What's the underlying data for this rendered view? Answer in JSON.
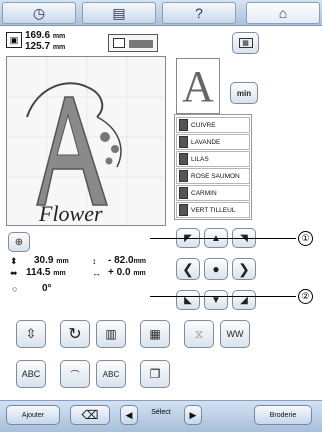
{
  "tabs": [
    {
      "icon": "clock-icon",
      "glyph": "◷"
    },
    {
      "icon": "document-icon",
      "glyph": "▤"
    },
    {
      "icon": "help-icon",
      "glyph": "?"
    },
    {
      "icon": "home-icon",
      "glyph": "⌂"
    }
  ],
  "size": {
    "width": "169.6",
    "height": "125.7",
    "unit": "mm"
  },
  "min_label": "min",
  "preview_letter": "A",
  "pattern_text": "Flower",
  "threads": [
    "CUIVRE",
    "LAVANDE",
    "LILAS",
    "ROSE SAUMON",
    "CARMIN",
    "VERT TILLEUL"
  ],
  "position": {
    "h": "30.9",
    "w": "114.5",
    "dy": "- 82.0",
    "dx": "+ 0.0",
    "rotation": "0°",
    "unit": "mm"
  },
  "callouts": [
    "①",
    "②"
  ],
  "bottom": {
    "ajouter": "Ajouter",
    "select": "Sélect",
    "broderie": "Broderie"
  },
  "colors": {
    "accent": "#a9c1dd",
    "frame": "#7f96b3"
  }
}
